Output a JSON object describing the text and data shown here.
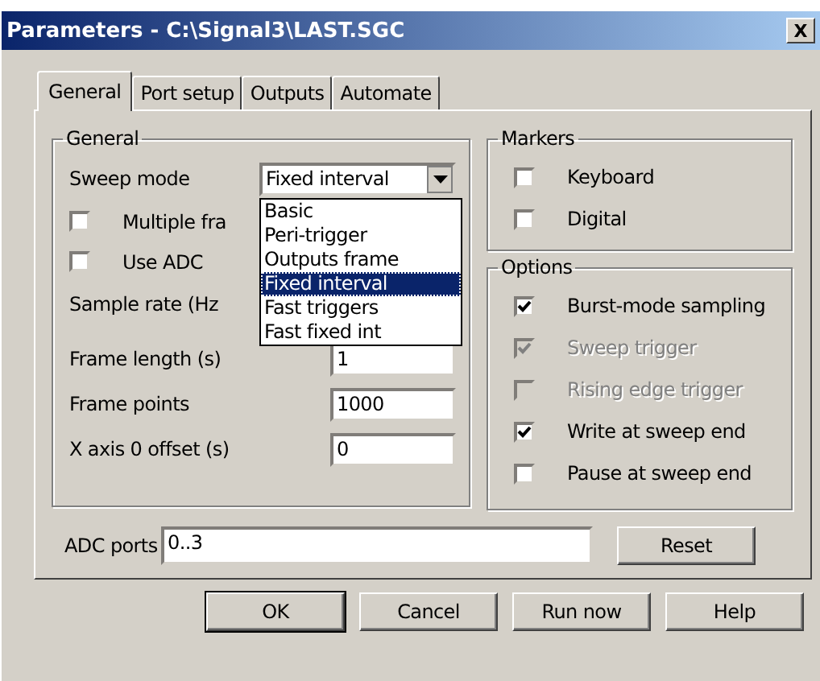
{
  "window": {
    "title": "Parameters - C:\\Signal3\\LAST.SGC",
    "close": "X"
  },
  "tabs": [
    {
      "label": "General",
      "selected": true
    },
    {
      "label": "Port setup",
      "selected": false
    },
    {
      "label": "Outputs",
      "selected": false
    },
    {
      "label": "Automate",
      "selected": false
    }
  ],
  "general": {
    "title": "General",
    "sweep_mode": {
      "label": "Sweep mode",
      "value": "Fixed interval",
      "expanded": true,
      "options": [
        {
          "label": "Basic",
          "selected": false
        },
        {
          "label": "Peri-trigger",
          "selected": false
        },
        {
          "label": "Outputs frame",
          "selected": false
        },
        {
          "label": "Fixed interval",
          "selected": true
        },
        {
          "label": "Fast triggers",
          "selected": false
        },
        {
          "label": "Fast fixed int",
          "selected": false
        }
      ]
    },
    "checks": [
      {
        "label": "Multiple fra",
        "checked": false
      },
      {
        "label": "Use ADC",
        "checked": false
      }
    ],
    "sample_rate": {
      "label": "Sample rate (Hz"
    },
    "fields": [
      {
        "label": "Frame length (s)",
        "value": "1"
      },
      {
        "label": "Frame points",
        "value": "1000"
      },
      {
        "label": "X axis 0 offset (s)",
        "value": "0"
      }
    ]
  },
  "markers": {
    "title": "Markers",
    "items": [
      {
        "label": "Keyboard",
        "checked": false,
        "disabled": false
      },
      {
        "label": "Digital",
        "checked": false,
        "disabled": false
      }
    ]
  },
  "options": {
    "title": "Options",
    "items": [
      {
        "label": "Burst-mode sampling",
        "checked": true,
        "disabled": false
      },
      {
        "label": "Sweep trigger",
        "checked": true,
        "disabled": true
      },
      {
        "label": "Rising edge trigger",
        "checked": false,
        "disabled": true
      },
      {
        "label": "Write at sweep end",
        "checked": true,
        "disabled": false
      },
      {
        "label": "Pause at sweep end",
        "checked": false,
        "disabled": false
      }
    ]
  },
  "adc_ports": {
    "label": "ADC ports",
    "value": "0..3"
  },
  "reset": "Reset",
  "buttons": [
    {
      "label": "OK",
      "default": true
    },
    {
      "label": "Cancel",
      "default": false
    },
    {
      "label": "Run now",
      "default": false
    },
    {
      "label": "Help",
      "default": false
    }
  ]
}
